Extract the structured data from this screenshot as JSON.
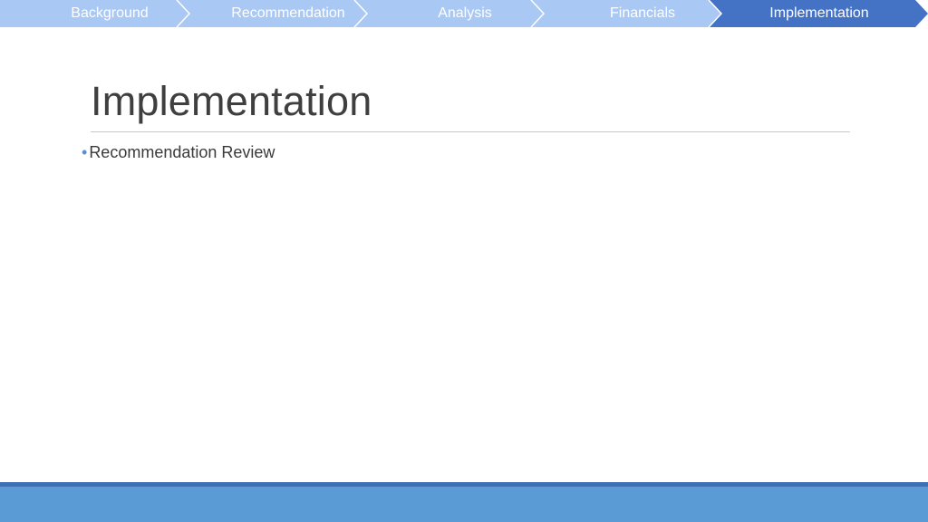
{
  "nav": {
    "items": [
      {
        "label": "Background",
        "active": false
      },
      {
        "label": "Recommendation",
        "active": false
      },
      {
        "label": "Analysis",
        "active": false
      },
      {
        "label": "Financials",
        "active": false
      },
      {
        "label": "Implementation",
        "active": true
      }
    ],
    "colors": {
      "inactive": "#a9c8f3",
      "active": "#4472c4",
      "separator": "#ffffff"
    }
  },
  "slide": {
    "title": "Implementation",
    "bullets": [
      "Recommendation Review"
    ]
  },
  "footer": {
    "band_color": "#5b9bd5",
    "accent_color": "#3f6fb5"
  }
}
